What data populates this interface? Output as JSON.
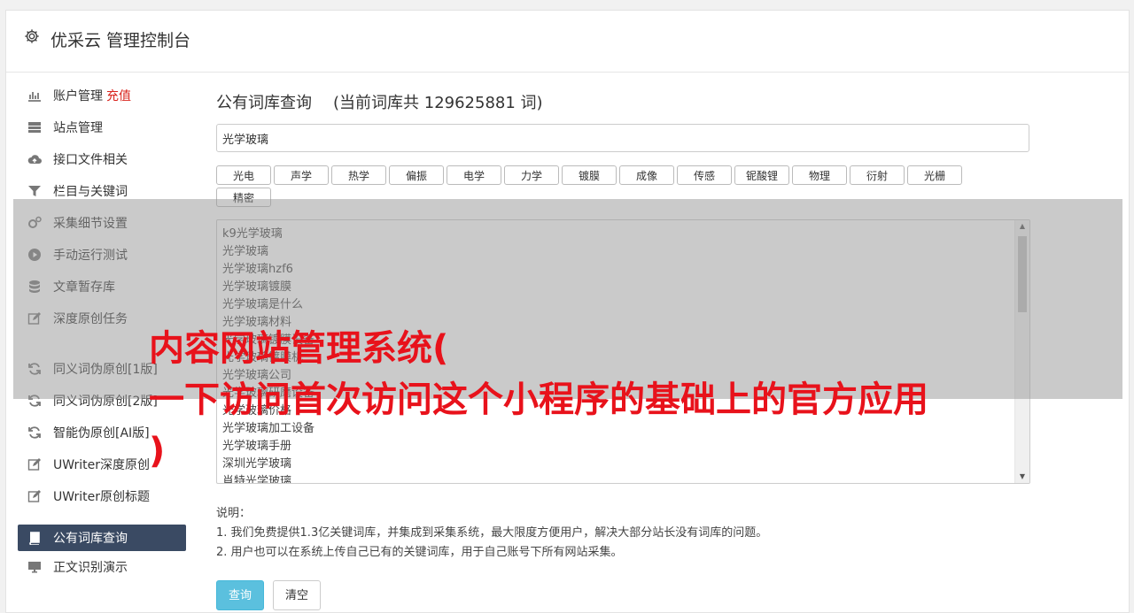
{
  "header": {
    "title": "优采云 管理控制台",
    "icon": "gear-icon"
  },
  "sidebar": {
    "items": [
      {
        "label": "账户管理",
        "extra": "充值",
        "icon": "bar-chart-icon"
      },
      {
        "label": "站点管理",
        "icon": "server-icon"
      },
      {
        "label": "接口文件相关",
        "icon": "cloud-upload-icon"
      },
      {
        "label": "栏目与关键词",
        "icon": "filter-icon"
      },
      {
        "label": "采集细节设置",
        "icon": "cogs-icon"
      },
      {
        "label": "手动运行测试",
        "icon": "play-circle-icon"
      },
      {
        "label": "文章暂存库",
        "icon": "database-icon"
      },
      {
        "label": "深度原创任务",
        "icon": "edit-icon"
      },
      {
        "label": "同义词伪原创[1版]",
        "icon": "refresh-icon"
      },
      {
        "label": "同义词伪原创[2版]",
        "icon": "refresh-icon"
      },
      {
        "label": "智能伪原创[AI版]",
        "icon": "refresh-icon"
      },
      {
        "label": "UWriter深度原创",
        "icon": "edit-icon"
      },
      {
        "label": "UWriter原创标题",
        "icon": "edit-icon"
      },
      {
        "label": "公有词库查询",
        "icon": "book-icon",
        "active": true
      },
      {
        "label": "正文识别演示",
        "icon": "monitor-icon"
      }
    ]
  },
  "main": {
    "title": "公有词库查询",
    "count_text": "(当前词库共 129625881 词)",
    "search_value": "光学玻璃",
    "tags": [
      "光电",
      "声学",
      "热学",
      "偏振",
      "电学",
      "力学",
      "镀膜",
      "成像",
      "传感",
      "铌酸锂",
      "物理",
      "衍射",
      "光栅",
      "精密"
    ],
    "results": [
      "k9光学玻璃",
      "光学玻璃",
      "光学玻璃hzf6",
      "光学玻璃镀膜",
      "光学玻璃是什么",
      "光学玻璃材料",
      "光学玻璃镀膜设备",
      "光学玻璃镀膜机",
      "光学玻璃公司",
      "光学玻璃研磨设备",
      "光学玻璃价格",
      "光学玻璃加工设备",
      "光学玻璃手册",
      "深圳光学玻璃",
      "肖特光学玻璃"
    ],
    "notes_title": "说明：",
    "notes": [
      "1. 我们免费提供1.3亿关键词库，并集成到采集系统，最大限度方便用户，解决大部分站长没有词库的问题。",
      "2. 用户也可以在系统上传自己已有的关键词库，用于自己账号下所有网站采集。"
    ],
    "query_button": "查询",
    "clear_button": "清空"
  },
  "overlay": {
    "line1": "内容网站管理系统(",
    "line2": "一下访问首次访问这个小程序的基础上的官方应用",
    "line3": ")",
    "color": "#e8121b"
  }
}
